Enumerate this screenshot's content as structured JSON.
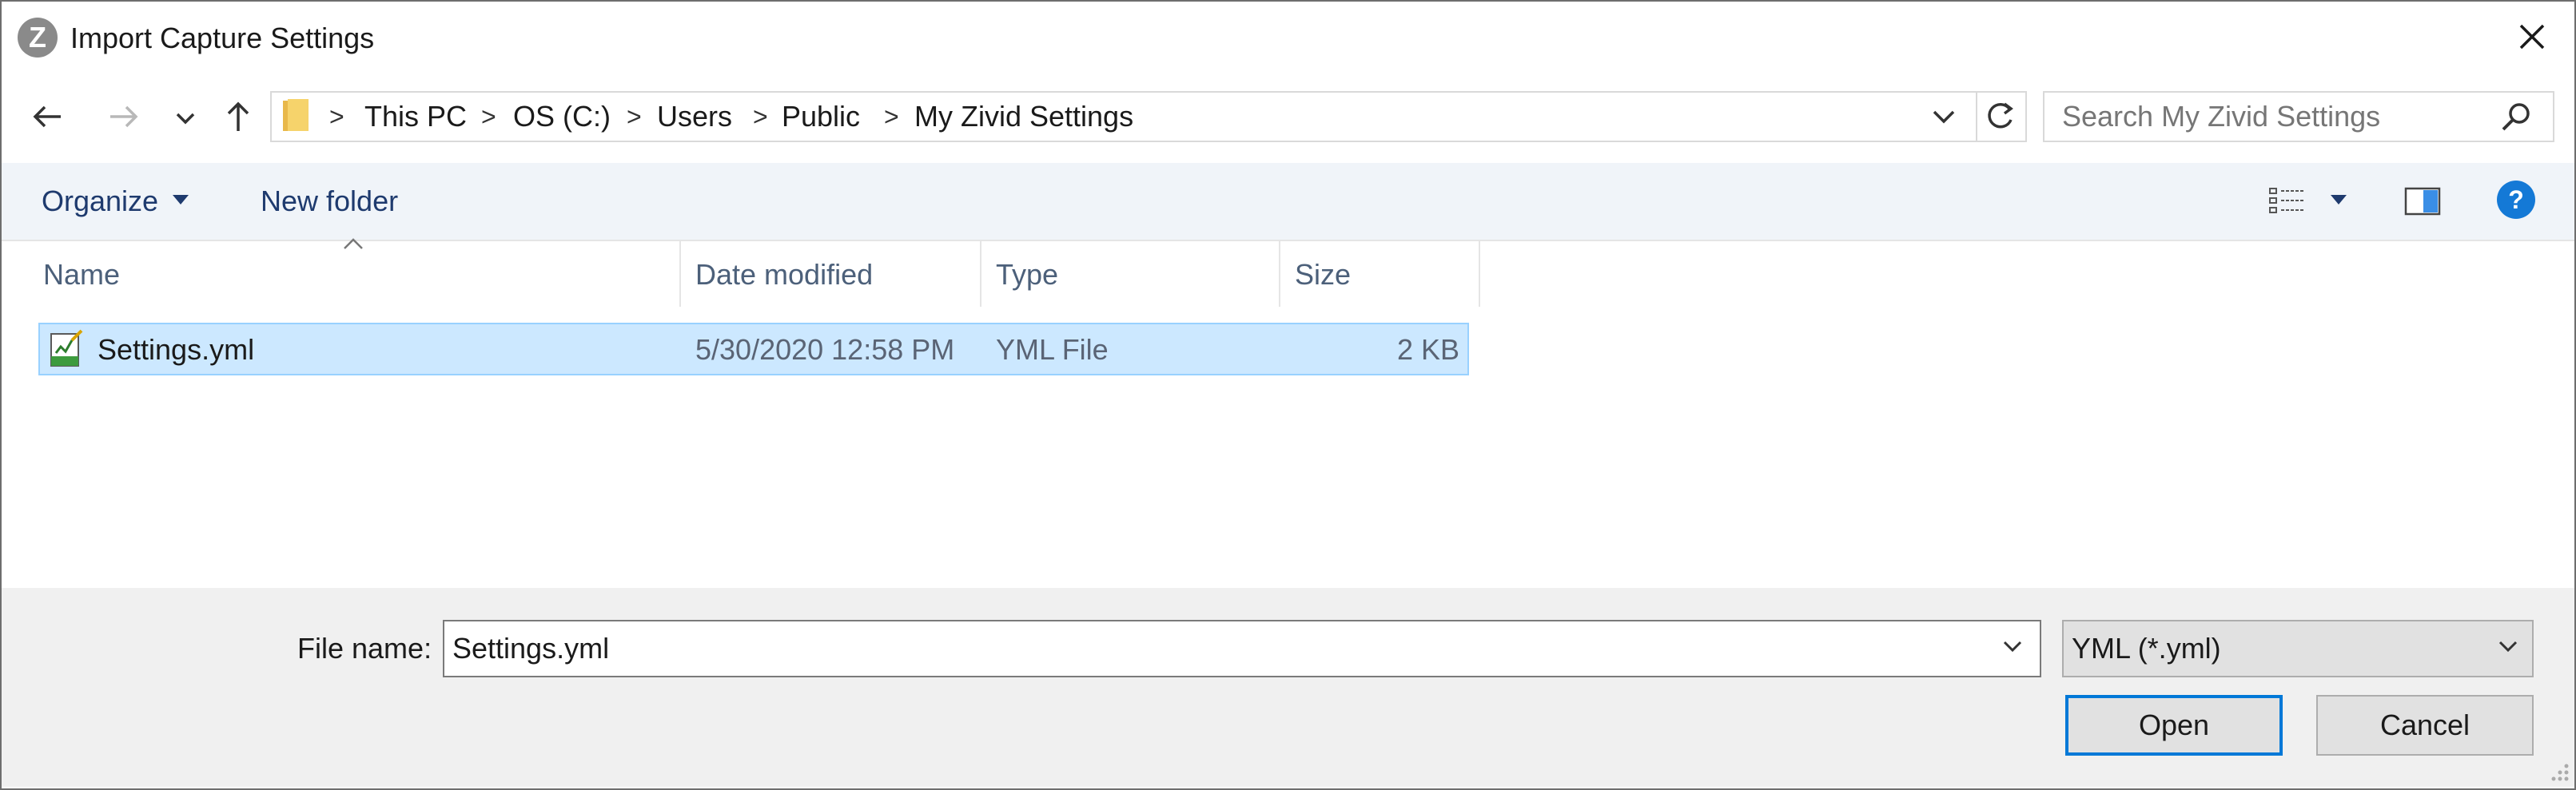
{
  "window": {
    "title": "Import Capture Settings"
  },
  "nav": {
    "breadcrumbs": [
      "This PC",
      "OS (C:)",
      "Users",
      "Public",
      "My Zivid Settings"
    ],
    "separator": ">",
    "search_placeholder": "Search My Zivid Settings"
  },
  "toolbar": {
    "organize_label": "Organize",
    "new_folder_label": "New folder"
  },
  "columns": {
    "name": "Name",
    "date_modified": "Date modified",
    "type": "Type",
    "size": "Size"
  },
  "files": [
    {
      "name": "Settings.yml",
      "date_modified": "5/30/2020 12:58 PM",
      "type": "YML File",
      "size": "2 KB"
    }
  ],
  "footer": {
    "file_name_label": "File name:",
    "file_name_value": "Settings.yml",
    "file_type_value": "YML (*.yml)",
    "open_label": "Open",
    "cancel_label": "Cancel"
  },
  "colors": {
    "accent": "#0078d7",
    "selection": "#cce8ff",
    "selection_border": "#99d1ff",
    "help": "#1479d6"
  },
  "icons": {
    "app": "zivid-logo-icon",
    "close": "close-icon",
    "back": "back-arrow-icon",
    "forward": "forward-arrow-icon",
    "recent": "chevron-down-icon",
    "up": "up-arrow-icon",
    "folder": "folder-icon",
    "refresh": "refresh-icon",
    "search": "search-icon",
    "view": "view-details-icon",
    "preview": "preview-pane-icon",
    "help": "help-icon",
    "file": "yml-file-icon"
  }
}
